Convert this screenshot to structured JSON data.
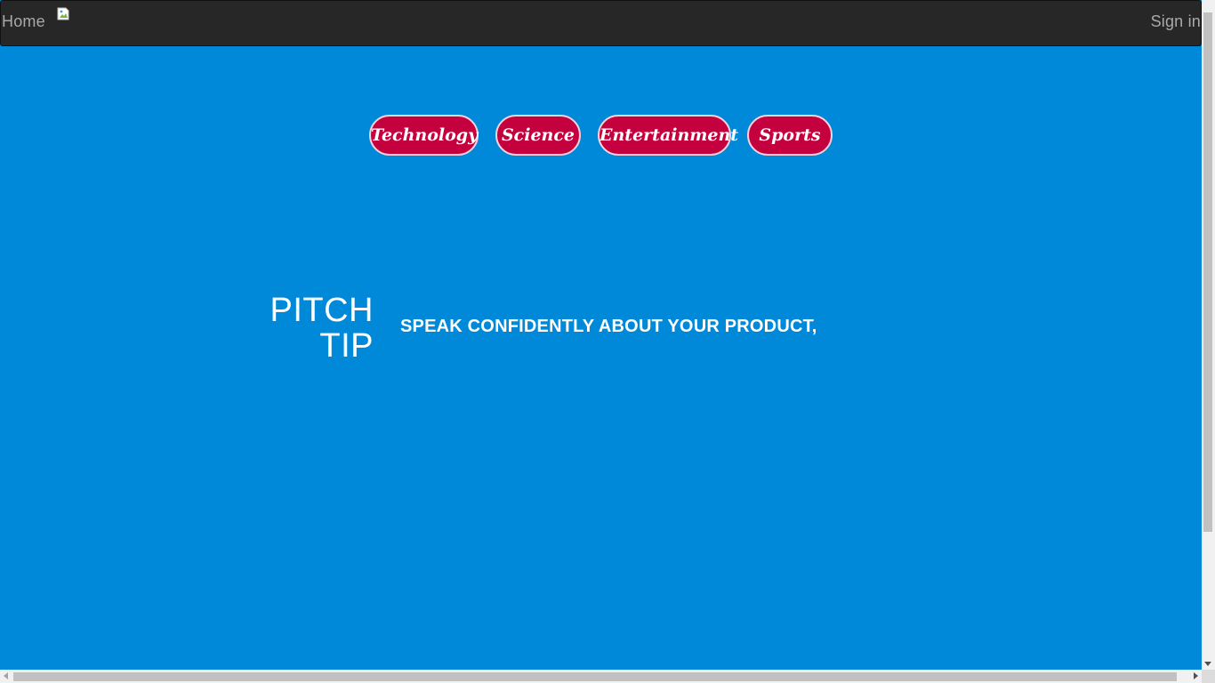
{
  "navbar": {
    "home_label": "Home",
    "logo_icon": "broken-image-icon",
    "signin_label": "Sign in",
    "background": "#272727",
    "text_color": "#a9a9a9"
  },
  "categories": {
    "items": [
      {
        "label": "Technology"
      },
      {
        "label": "Science"
      },
      {
        "label": "Entertainment"
      },
      {
        "label": "Sports"
      }
    ],
    "pill_color": "#c4003f"
  },
  "pitch": {
    "label_line1": "PITCH",
    "label_line2": "TIP",
    "text": "SPEAK CONFIDENTLY ABOUT YOUR PRODUCT,"
  },
  "colors": {
    "page_background": "#0088d9"
  }
}
